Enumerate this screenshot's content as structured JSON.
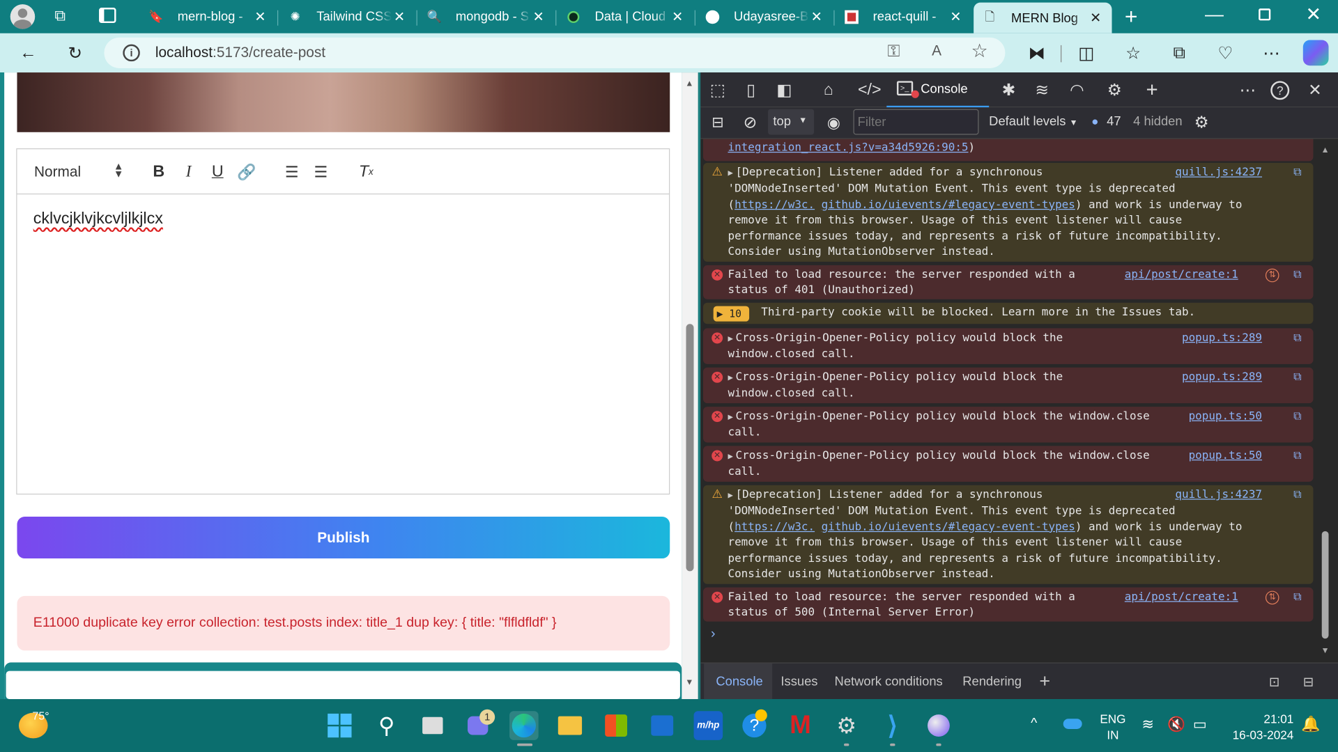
{
  "browser": {
    "tabs": [
      {
        "label": "mern-blog - ",
        "icon": "bookmark-icon"
      },
      {
        "label": "Tailwind CSS",
        "icon": "chatgpt-icon"
      },
      {
        "label": "mongodb - S",
        "icon": "search-icon"
      },
      {
        "label": "Data | Cloud",
        "icon": "mongodb-leaf-icon"
      },
      {
        "label": "Udayasree-B",
        "icon": "github-icon"
      },
      {
        "label": "react-quill - ",
        "icon": "npm-icon"
      },
      {
        "label": "MERN Blog",
        "icon": "page-icon",
        "active": true
      }
    ],
    "url_host": "localhost",
    "url_path": ":5173/create-post"
  },
  "page": {
    "editor": {
      "format_select": "Normal",
      "content": "cklvcjklvjkcvljlkjlcx"
    },
    "publish_label": "Publish",
    "error_message": "E11000 duplicate key error collection: test.posts index: title_1 dup key: { title: \"flfldfldf\" }"
  },
  "devtools": {
    "active_tab": "Console",
    "context": "top",
    "filter_placeholder": "Filter",
    "levels": "Default levels",
    "message_count": "47",
    "hidden": "4 hidden",
    "top_cut_text": "integration_react.js?v=a34d5926:90:5",
    "top_cut_suffix": ")",
    "deprecation": {
      "lead": "[Deprecation] Listener added for a synchronous",
      "line2a": "'DOMNodeInserted' DOM Mutation Event. This event type is deprecated (",
      "link1": "https://w3c.",
      "link2": "github.io/uievents/#legacy-event-types",
      "rest": ") and work is underway to remove it from this browser. Usage of this event listener will cause performance issues today, and represents a risk of future incompatibility. Consider using MutationObserver instead.",
      "source": "quill.js:4237"
    },
    "err401": {
      "text": "Failed to load resource: the server responded with a status of 401 (Unauthorized)",
      "source": "api/post/create:1"
    },
    "issues": {
      "count": "10",
      "text": "Third-party cookie will be blocked. Learn more in the Issues tab."
    },
    "coop": [
      {
        "text": "Cross-Origin-Opener-Policy policy would block the window.closed call.",
        "source": "popup.ts:289"
      },
      {
        "text": "Cross-Origin-Opener-Policy policy would block the window.closed call.",
        "source": "popup.ts:289"
      },
      {
        "text": "Cross-Origin-Opener-Policy policy would block the window.close call.",
        "source": "popup.ts:50"
      },
      {
        "text": "Cross-Origin-Opener-Policy policy would block the window.close call.",
        "source": "popup.ts:50"
      }
    ],
    "err500": {
      "text": "Failed to load resource: the server responded with a status of 500 (Internal Server Error)",
      "source": "api/post/create:1"
    },
    "drawer_tabs": [
      "Console",
      "Issues",
      "Network conditions",
      "Rendering"
    ]
  },
  "taskbar": {
    "weather": "75°",
    "chat_badge": "1",
    "lang": "ENG",
    "region": "IN",
    "time": "21:01",
    "date": "16-03-2024"
  },
  "colors": {
    "accent": "#0f7e80",
    "publish_start": "#7b47ee",
    "publish_end": "#1bb7dc",
    "error_text": "#c8232c"
  }
}
